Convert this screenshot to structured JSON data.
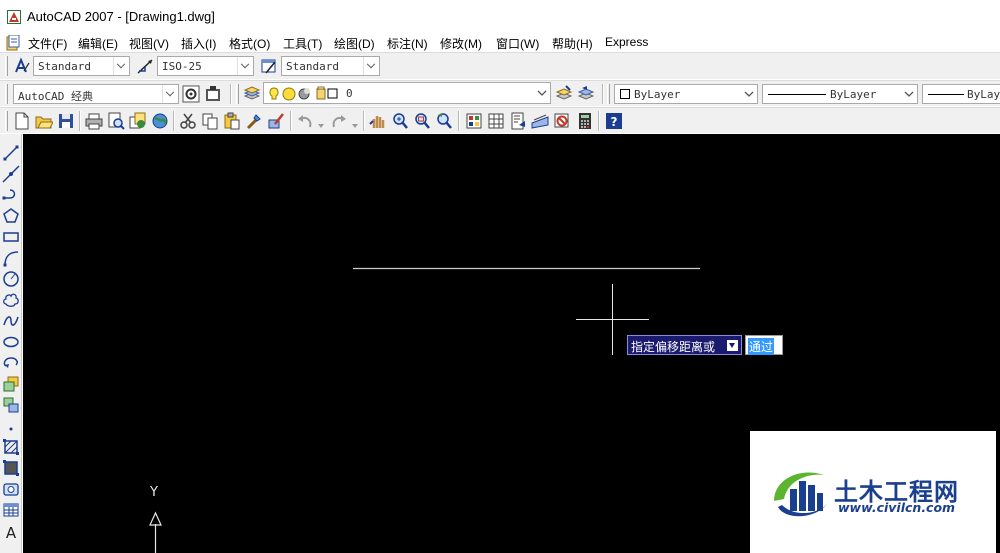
{
  "window": {
    "title": "AutoCAD 2007 - [Drawing1.dwg]"
  },
  "menu": {
    "items": [
      "文件(F)",
      "编辑(E)",
      "视图(V)",
      "插入(I)",
      "格式(O)",
      "工具(T)",
      "绘图(D)",
      "标注(N)",
      "修改(M)",
      "窗口(W)",
      "帮助(H)",
      "Express"
    ]
  },
  "styles_toolbar": {
    "text_style": "Standard",
    "dim_style": "ISO-25",
    "table_style": "Standard"
  },
  "workspace_toolbar": {
    "workspace": "AutoCAD 经典",
    "layer": "0",
    "color": "ByLayer",
    "linetype": "ByLayer",
    "lineweight": "ByLayer"
  },
  "command": {
    "prompt": "指定偏移距离或",
    "input_value": "通过"
  },
  "ucs": {
    "y_label": "Y"
  },
  "watermark": {
    "site_name": "土木工程网",
    "url": "www.civilcn.com"
  },
  "colors": {
    "canvas": "#000000",
    "toolbar": "#f0f0f0",
    "prompt_bg": "#1a1a6e",
    "selection": "#3399ff",
    "watermark_blue": "#1b3f8f",
    "watermark_green": "#5cb531"
  }
}
